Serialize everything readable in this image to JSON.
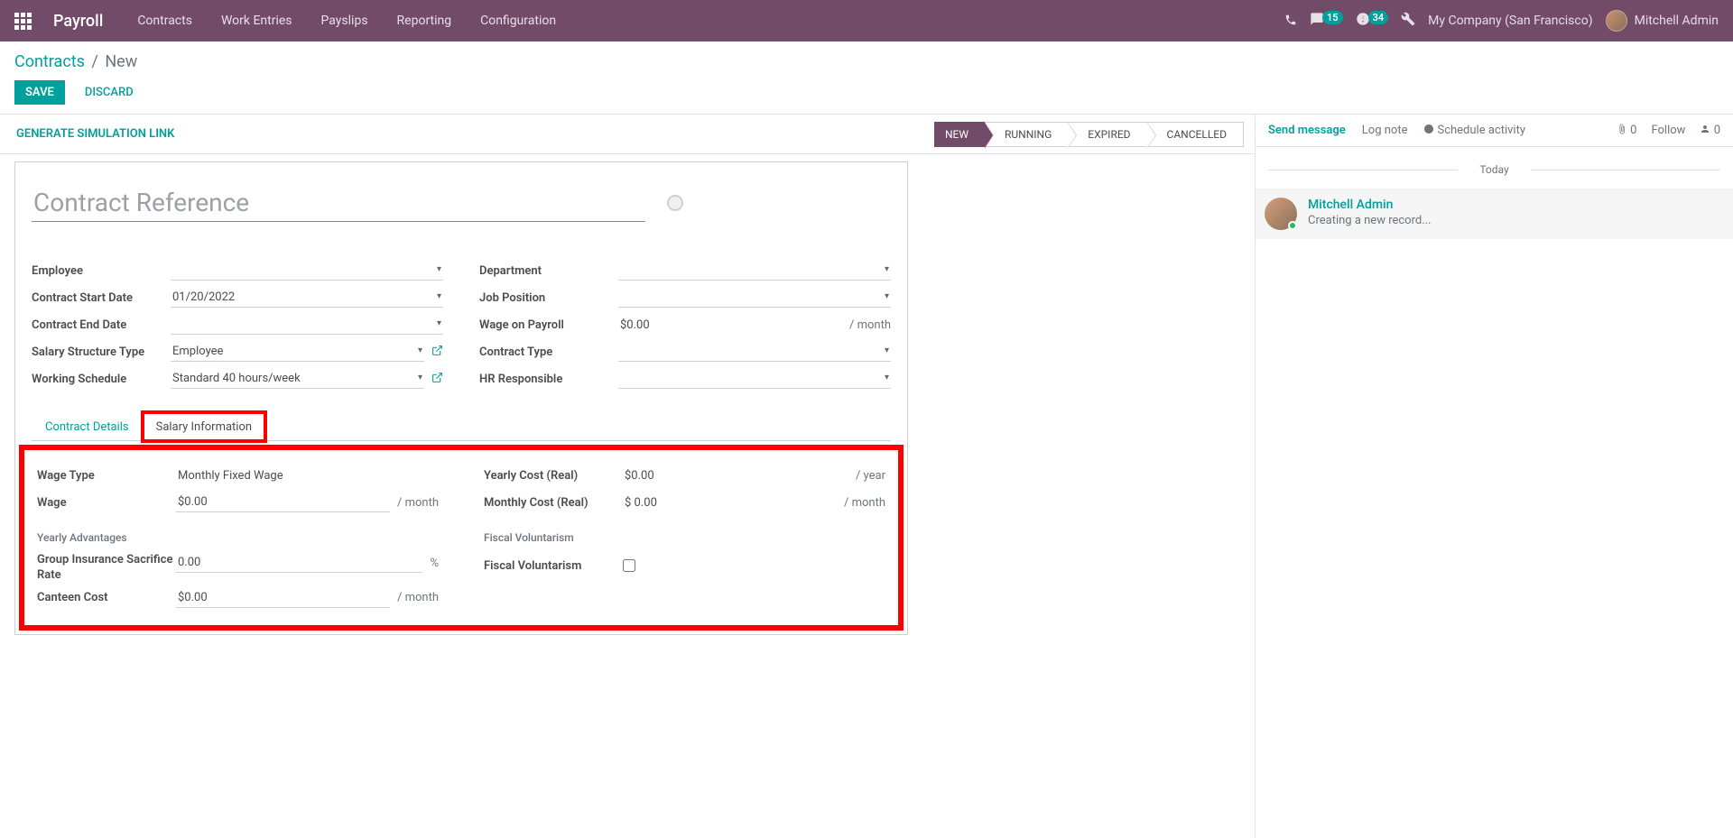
{
  "navbar": {
    "brand": "Payroll",
    "menu": [
      "Contracts",
      "Work Entries",
      "Payslips",
      "Reporting",
      "Configuration"
    ],
    "chat_badge": "15",
    "clock_badge": "34",
    "company": "My Company (San Francisco)",
    "user": "Mitchell Admin"
  },
  "breadcrumb": {
    "link": "Contracts",
    "current": "New"
  },
  "buttons": {
    "save": "SAVE",
    "discard": "DISCARD"
  },
  "statusbar": {
    "gen_link": "GENERATE SIMULATION LINK",
    "steps": [
      "NEW",
      "RUNNING",
      "EXPIRED",
      "CANCELLED"
    ]
  },
  "form": {
    "title_placeholder": "Contract Reference",
    "labels": {
      "employee": "Employee",
      "start_date": "Contract Start Date",
      "end_date": "Contract End Date",
      "salary_struct": "Salary Structure Type",
      "working_schedule": "Working Schedule",
      "department": "Department",
      "job_position": "Job Position",
      "wage_on_payroll": "Wage on Payroll",
      "contract_type": "Contract Type",
      "hr_responsible": "HR Responsible"
    },
    "values": {
      "start_date": "01/20/2022",
      "salary_struct": "Employee",
      "working_schedule": "Standard 40 hours/week",
      "wage_on_payroll": "$0.00",
      "wage_on_payroll_suffix": "/ month"
    }
  },
  "tabs": {
    "details": "Contract Details",
    "salary": "Salary Information"
  },
  "salary": {
    "labels": {
      "wage_type": "Wage Type",
      "wage": "Wage",
      "yearly_cost": "Yearly Cost (Real)",
      "monthly_cost": "Monthly Cost (Real)",
      "yearly_adv": "Yearly Advantages",
      "fiscal_vol_section": "Fiscal Voluntarism",
      "group_ins": "Group Insurance Sacrifice Rate",
      "canteen": "Canteen Cost",
      "fiscal_vol": "Fiscal Voluntarism"
    },
    "values": {
      "wage_type": "Monthly Fixed Wage",
      "wage": "$0.00",
      "wage_suffix": "/ month",
      "yearly_cost": "$0.00",
      "yearly_cost_suffix": "/ year",
      "monthly_cost": "$ 0.00",
      "monthly_cost_suffix": "/ month",
      "group_ins": "0.00",
      "group_ins_suffix": "%",
      "canteen": "$0.00",
      "canteen_suffix": "/ month"
    }
  },
  "chatter": {
    "send": "Send message",
    "log": "Log note",
    "schedule": "Schedule activity",
    "attach_count": "0",
    "follow": "Follow",
    "follower_count": "0",
    "today": "Today",
    "author": "Mitchell Admin",
    "msg": "Creating a new record..."
  }
}
